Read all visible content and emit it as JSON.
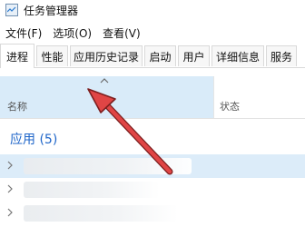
{
  "window": {
    "title": "任务管理器"
  },
  "menu": [
    "文件(F)",
    "选项(O)",
    "查看(V)"
  ],
  "tabs": [
    "进程",
    "性能",
    "应用历史记录",
    "启动",
    "用户",
    "详细信息",
    "服务"
  ],
  "active_tab": "进程",
  "columns": {
    "name": "名称",
    "status": "状态"
  },
  "section": {
    "title": "应用 (5)"
  },
  "colors": {
    "accent": "#1f66c9",
    "sort_highlight": "#d9ebf9",
    "annotation_arrow": "#d33a3a"
  },
  "icons": [
    "task-manager-icon",
    "sort-ascending-icon",
    "expand-chevron-icon",
    "annotation-arrow"
  ]
}
